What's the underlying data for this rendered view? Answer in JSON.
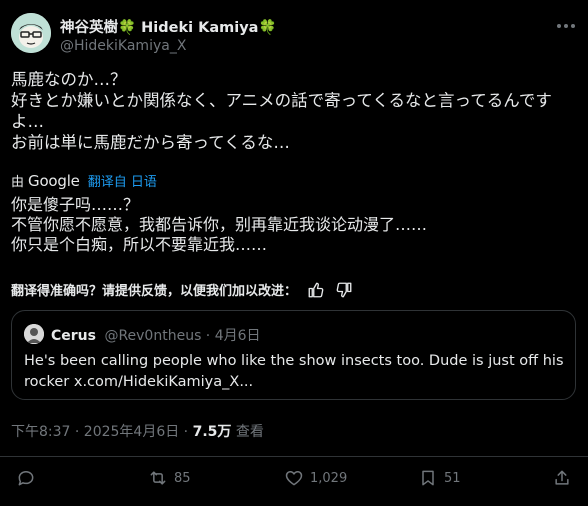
{
  "author": {
    "name": "神谷英樹",
    "clover": "🍀",
    "name_latin": "Hideki Kamiya",
    "handle": "@HidekiKamiya_X"
  },
  "post": {
    "lines": [
      "馬鹿なのか…？",
      "好きとか嫌いとか関係なく、アニメの話で寄ってくるなと言ってるんです",
      "よ…",
      "お前は単に馬鹿だから寄ってくるな…"
    ]
  },
  "translation_bar": {
    "prefix": "由",
    "brand": "Google",
    "link": "翻译自 日语"
  },
  "translation": {
    "lines": [
      "你是傻子吗……？",
      "不管你愿不愿意，我都告诉你，别再靠近我谈论动漫了……",
      "你只是个白痴，所以不要靠近我……"
    ]
  },
  "feedback": {
    "text": "翻译得准确吗？请提供反馈，以便我们加以改进："
  },
  "quote": {
    "name": "Cerus",
    "handle_date": "@Rev0ntheus · 4月6日",
    "lines": [
      "He's been calling people who like the show insects too. Dude is just off his",
      "rocker x.com/HidekiKamiya_X..."
    ]
  },
  "meta": {
    "timestamp": "下午8:37 · 2025年4月6日 · ",
    "views": "7.5万",
    "views_label": " 查看"
  },
  "actions": {
    "replies": "",
    "reposts": "85",
    "likes": "1,029",
    "bookmarks": "51"
  },
  "colors": {
    "background": "#000000",
    "text": "#e7e9ea",
    "secondary": "#71767b",
    "accent": "#1d9bf0",
    "clover": "#3aa655"
  }
}
